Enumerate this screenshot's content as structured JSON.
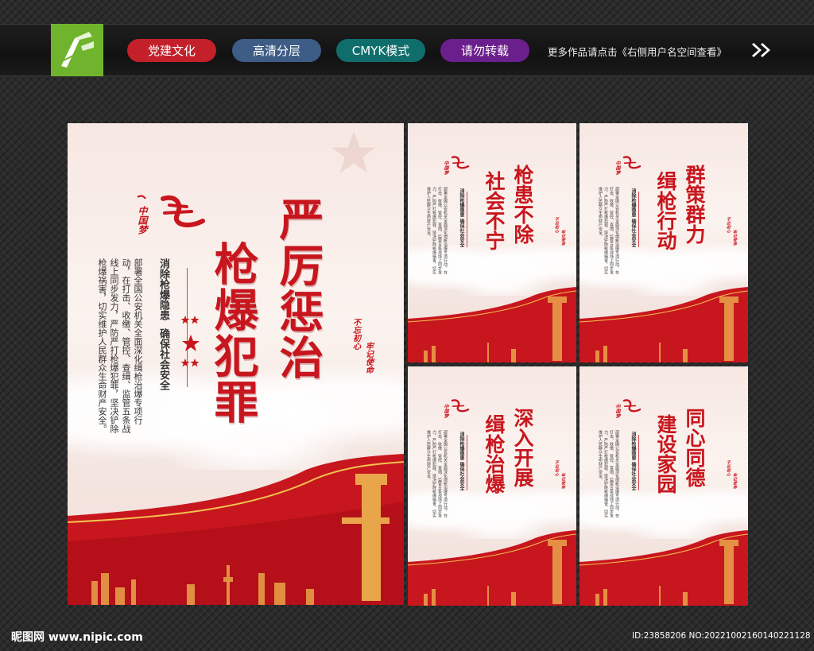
{
  "header": {
    "tags": [
      "党建文化",
      "高清分层",
      "CMYK模式",
      "请勿转载"
    ],
    "more_text": "更多作品请点击《右侧用户名空间查看》"
  },
  "main_poster": {
    "title_col1": "严厉惩治",
    "title_col2": "枪爆犯罪",
    "subtitle_1": "消除枪爆隐患",
    "subtitle_2": "确保社会安全",
    "body": "部署全国公安机关全面深化缉枪治爆专项行动，在打击、收缴、管控、查缉、监管五条战线上同步发力，严防严打枪爆犯罪，坚决铲除枪爆祸害，切实维护人民群众生命财产安全。",
    "seal_1": "不忘初心",
    "seal_2": "牢记使命",
    "logo_text": "中国梦"
  },
  "small_posters": [
    {
      "title_col1": "枪患不除",
      "title_col2": "社会不宁"
    },
    {
      "title_col1": "群策群力",
      "title_col2": "缉枪行动"
    },
    {
      "title_col1": "深入开展",
      "title_col2": "缉枪治爆"
    },
    {
      "title_col1": "同心同德",
      "title_col2": "建设家园"
    }
  ],
  "footer": {
    "watermark_left": "昵图网 www.nipic.com",
    "watermark_right": "ID:23858206 NO:20221002160140221128"
  },
  "colors": {
    "poster_red": "#c8161e",
    "logo_green": "#6fb42c",
    "tag_red": "#c4202a",
    "tag_blue": "#3d5c86",
    "tag_teal": "#0f6e6c",
    "tag_purple": "#6b1f8c"
  }
}
